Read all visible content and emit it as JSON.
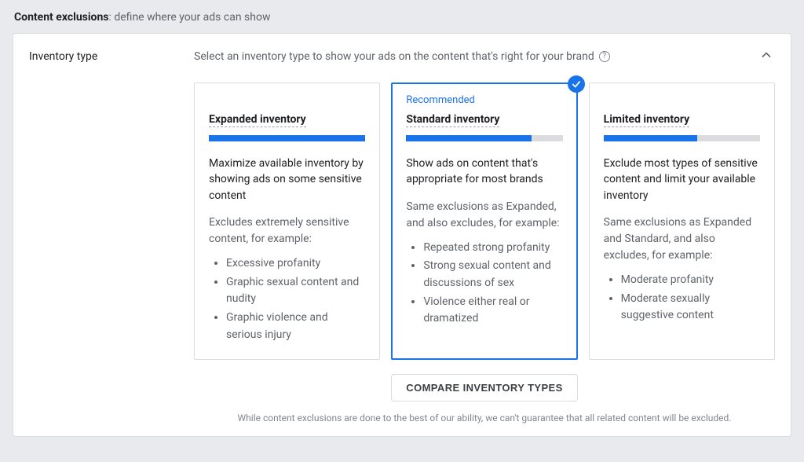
{
  "header": {
    "title": "Content exclusions",
    "subtitle": ": define where your ads can show"
  },
  "panel": {
    "label": "Inventory type",
    "description": "Select an inventory type to show your ads on the content that's right for your brand",
    "collapsed": false
  },
  "cards": [
    {
      "id": "expanded",
      "recommended": false,
      "selected": false,
      "title": "Expanded inventory",
      "bar_fill_pct": 100,
      "desc": "Maximize available inventory by showing ads on some sensitive content",
      "sub": "Excludes extremely sensitive content, for example:",
      "bullets": [
        "Excessive profanity",
        "Graphic sexual content and nudity",
        "Graphic violence and serious injury"
      ]
    },
    {
      "id": "standard",
      "recommended": true,
      "selected": true,
      "recommended_label": "Recommended",
      "title": "Standard inventory",
      "bar_fill_pct": 80,
      "desc": "Show ads on content that's appropriate for most brands",
      "sub": "Same exclusions as Expanded, and also excludes, for example:",
      "bullets": [
        "Repeated strong profanity",
        "Strong sexual content and discussions of sex",
        "Violence either real or dramatized"
      ]
    },
    {
      "id": "limited",
      "recommended": false,
      "selected": false,
      "title": "Limited inventory",
      "bar_fill_pct": 60,
      "desc": "Exclude most types of sensitive content and limit your available inventory",
      "sub": "Same exclusions as Expanded and Standard, and also excludes, for example:",
      "bullets": [
        "Moderate profanity",
        "Moderate sexually suggestive content"
      ]
    }
  ],
  "compare_button": "COMPARE INVENTORY TYPES",
  "disclaimer": "While content exclusions are done to the best of our ability, we can't guarantee that all related content will be excluded."
}
